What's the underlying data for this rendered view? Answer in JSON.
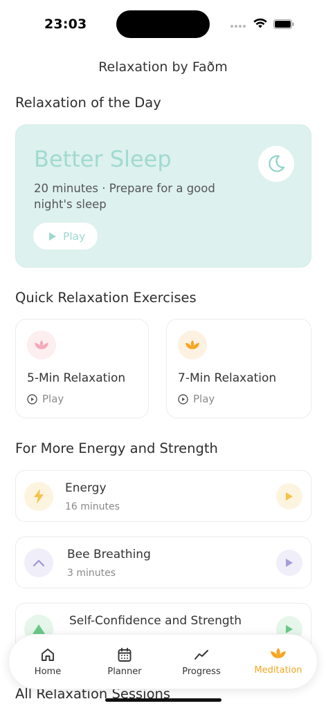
{
  "status": {
    "time": "23:03"
  },
  "app": {
    "title": "Relaxation by Faðm"
  },
  "day": {
    "section_title": "Relaxation of the Day",
    "card": {
      "title": "Better Sleep",
      "subtitle": "20 minutes · Prepare for a good night's sleep",
      "play_label": "Play",
      "icon": "moon-icon"
    }
  },
  "quick": {
    "section_title": "Quick Relaxation Exercises",
    "items": [
      {
        "name": "5-Min Relaxation",
        "play_label": "Play",
        "icon": "lotus-icon",
        "color": "#f5a9b8"
      },
      {
        "name": "7-Min Relaxation",
        "play_label": "Play",
        "icon": "lotus-icon",
        "color": "#f5a623"
      }
    ]
  },
  "energy": {
    "section_title": "For More Energy and Strength",
    "items": [
      {
        "title": "Energy",
        "subtitle": "16 minutes",
        "icon": "lightning-icon",
        "color": "#f5c24a"
      },
      {
        "title": "Bee Breathing",
        "subtitle": "3 minutes",
        "icon": "chevron-up-icon",
        "color": "#a99cd8"
      },
      {
        "title": "Self-Confidence and Strength",
        "subtitle": "",
        "icon": "triangle-icon",
        "color": "#6cc88a"
      }
    ]
  },
  "all_sessions": {
    "section_title": "All Relaxation Sessions"
  },
  "nav": {
    "tabs": [
      {
        "label": "Home",
        "icon": "home-icon"
      },
      {
        "label": "Planner",
        "icon": "calendar-icon"
      },
      {
        "label": "Progress",
        "icon": "chart-line-icon"
      },
      {
        "label": "Meditation",
        "icon": "lotus-icon",
        "active": true
      }
    ],
    "accent": "#f5a623"
  }
}
